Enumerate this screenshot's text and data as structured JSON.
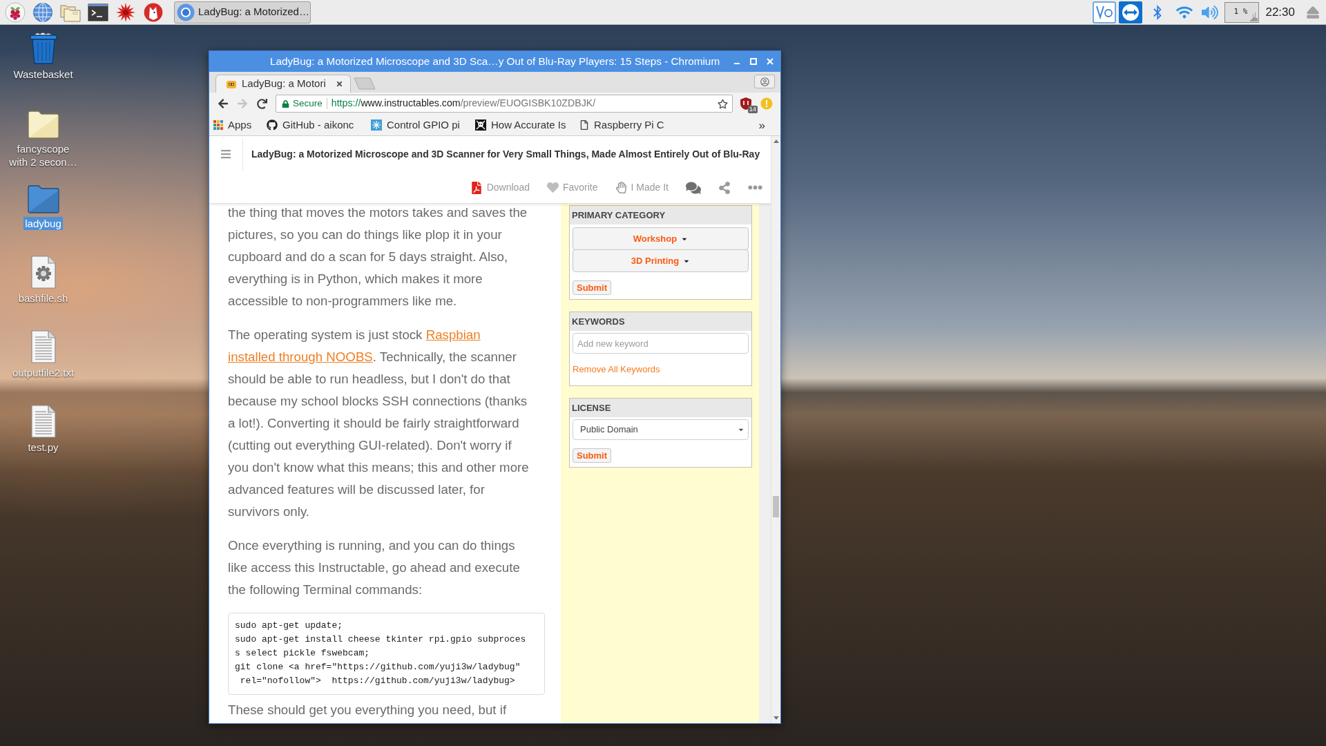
{
  "taskbar": {
    "task_button": {
      "label": "LadyBug: a Motorized…"
    },
    "cpu_monitor": {
      "reading": "1 %"
    },
    "clock": "22:30"
  },
  "desktop_icons": [
    {
      "label": "Wastebasket",
      "kind": "trash",
      "selected": false
    },
    {
      "label": "fancyscope with 2 secon…",
      "kind": "folder",
      "selected": false
    },
    {
      "label": "ladybug",
      "kind": "folder",
      "selected": true
    },
    {
      "label": "bashfile.sh",
      "kind": "script",
      "selected": false
    },
    {
      "label": "outputfile2.txt",
      "kind": "text",
      "selected": false
    },
    {
      "label": "test.py",
      "kind": "text",
      "selected": false
    }
  ],
  "browser": {
    "title": "LadyBug: a Motorized Microscope and 3D Sca…y Out of Blu-Ray Players: 15 Steps - Chromium",
    "tabs": [
      {
        "title": "LadyBug: a Motori",
        "selected": true
      }
    ],
    "navigation": [
      {
        "kind": "back",
        "disabled": false
      },
      {
        "kind": "forward",
        "disabled": true
      },
      {
        "kind": "reload",
        "disabled": false
      }
    ],
    "address": {
      "security": "Secure",
      "scheme": "https://",
      "host": "www.instructables.com",
      "path": "/preview/EUOGISBK10ZDBJK/"
    },
    "extension_badge": "14",
    "bookmarks": [
      {
        "label": "Apps",
        "kind": "apps"
      },
      {
        "label": "GitHub - aikonc",
        "kind": "github"
      },
      {
        "label": "Control GPIO pi",
        "kind": "snowflake"
      },
      {
        "label": "How Accurate Is",
        "kind": "skull"
      },
      {
        "label": "Raspberry Pi C",
        "kind": "page"
      }
    ],
    "bookmarks_overflow": "»"
  },
  "page": {
    "title": "LadyBug: a Motorized Microscope and 3D Scanner for Very Small Things, Made Almost Entirely Out of Blu-Ray",
    "actions": [
      {
        "kind": "download",
        "label": "Download"
      },
      {
        "kind": "favorite",
        "label": "Favorite"
      },
      {
        "kind": "made",
        "label": "I Made It"
      },
      {
        "kind": "comments"
      },
      {
        "kind": "share"
      },
      {
        "kind": "more"
      }
    ],
    "article": [
      {
        "kind": "paragraph",
        "parts": [
          {
            "text": "the thing that moves the motors takes and saves the pictures, so you can do things like plop it in your cupboard and do a scan for 5 days straight. Also, everything is in Python, which makes it more accessible to non-programmers like me.",
            "link": false
          }
        ]
      },
      {
        "kind": "paragraph",
        "parts": [
          {
            "text": "The operating system is just stock ",
            "link": false
          },
          {
            "text": "Raspbian ",
            "link": true
          },
          {
            "text": "installed through NOOBS",
            "link": true
          },
          {
            "text": ". Technically, the scanner should be able to run headless, but I don't do that because my school blocks SSH connections (thanks a lot!). Converting it should be fairly straightforward (cutting out everything GUI-related). Don't worry if you don't know what this means; this and other more advanced features will be discussed later, for survivors only.",
            "link": false
          }
        ]
      },
      {
        "kind": "paragraph",
        "parts": [
          {
            "text": "Once everything is running, and you can do things like access this Instructable, go ahead and execute the following Terminal commands:",
            "link": false
          }
        ]
      },
      {
        "kind": "code",
        "lines": [
          "sudo apt-get update;",
          "sudo apt-get install cheese tkinter rpi.gpio subproces",
          "s select pickle fswebcam;",
          "git clone <a href=\"https://github.com/yuji3w/ladybug\"",
          " rel=\"nofollow\">  https://github.com/yuji3w/ladybug>"
        ]
      },
      {
        "kind": "paragraph",
        "parts": [
          {
            "text": "These should get you everything you need, but if",
            "link": false
          }
        ]
      }
    ],
    "sidebar": [
      {
        "kind": "category",
        "heading": "PRIMARY CATEGORY",
        "dropdowns": [
          "Workshop",
          "3D Printing"
        ],
        "submit": "Submit"
      },
      {
        "kind": "keywords",
        "heading": "KEYWORDS",
        "placeholder": "Add new keyword",
        "link": "Remove All Keywords"
      },
      {
        "kind": "license",
        "heading": "LICENSE",
        "value": "Public Domain",
        "submit": "Submit"
      }
    ]
  }
}
